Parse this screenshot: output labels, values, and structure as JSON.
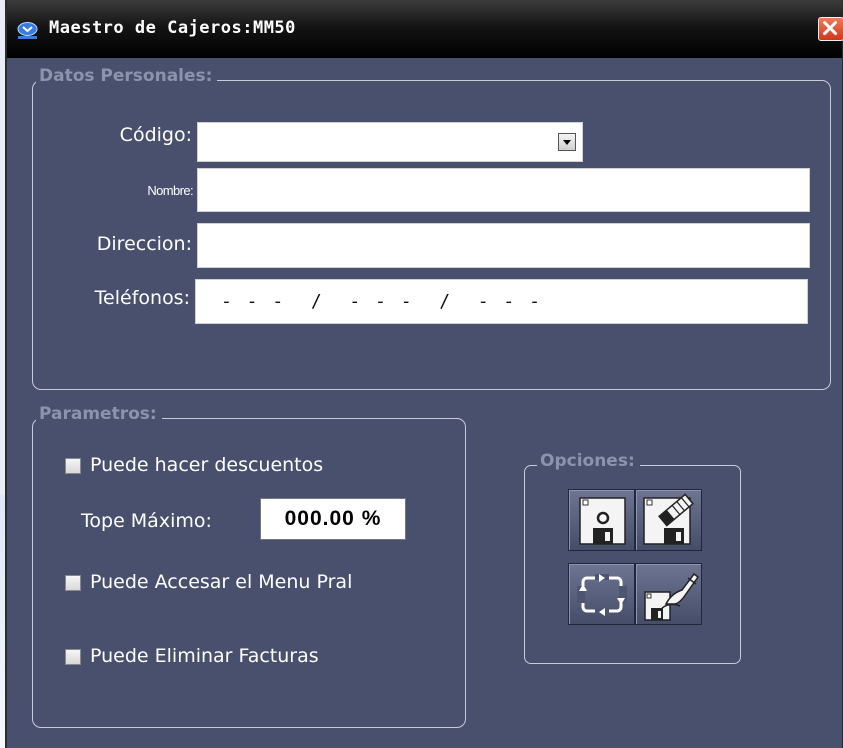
{
  "window": {
    "title": "Maestro de Cajeros:MM50"
  },
  "datos_personales": {
    "legend": "Datos Personales:",
    "codigo_label": "Código:",
    "codigo_value": "",
    "nombre_label": "Nombre:",
    "nombre_value": "",
    "direccion_label": "Direccion:",
    "direccion_value": "",
    "telefonos_label": "Teléfonos:",
    "telefonos_mask": "- - -  /  - - -  /  - - -"
  },
  "parametros": {
    "legend": "Parametros:",
    "descuentos_label": "Puede hacer descuentos",
    "descuentos_checked": false,
    "tope_label": "Tope Máximo:",
    "tope_value": "000.00 %",
    "menu_label": "Puede Accesar el Menu Pral",
    "menu_checked": false,
    "eliminar_label": "Puede Eliminar Facturas",
    "eliminar_checked": false
  },
  "opciones": {
    "legend": "Opciones:",
    "buttons": [
      "save-icon",
      "clear-icon",
      "refresh-icon",
      "edit-icon"
    ]
  },
  "colors": {
    "window_bg": "#48506e",
    "legend_text": "#8c93ab",
    "close_button": "#d3361b"
  }
}
